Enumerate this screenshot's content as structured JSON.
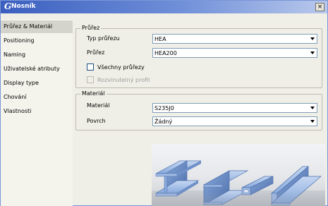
{
  "window": {
    "title": "Nosník",
    "icon": "profile-g-icon",
    "close_label": "×"
  },
  "sidebar": {
    "items": [
      {
        "label": "Průřez & Materiál",
        "active": true
      },
      {
        "label": "Positioning",
        "active": false
      },
      {
        "label": "Naming",
        "active": false
      },
      {
        "label": "Uživatelské atributy",
        "active": false
      },
      {
        "label": "Display type",
        "active": false
      },
      {
        "label": "Chování",
        "active": false
      },
      {
        "label": "Vlastnosti",
        "active": false
      }
    ]
  },
  "profile_group": {
    "title": "Průřez",
    "type_label": "Typ průřezu",
    "type_value": "HEA",
    "profile_label": "Průřez",
    "profile_value": "HEA200",
    "all_profiles_label": "Všechny průřezy",
    "all_profiles_checked": false,
    "parametric_label": "Rozvinutelný profil",
    "parametric_checked": false,
    "parametric_enabled": false
  },
  "material_group": {
    "title": "Materiál",
    "material_label": "Materiál",
    "material_value": "S235J0",
    "surface_label": "Povrch",
    "surface_value": "Žádný"
  },
  "preview": {
    "icon": "steel-profiles-illustration",
    "colors": {
      "steel_light": "#c6d8f3",
      "steel_mid": "#87a9dc",
      "steel_dark": "#4d6ea9"
    }
  },
  "colors": {
    "titlebar_start": "#3b5fbf",
    "titlebar_end": "#b9c9ec",
    "panel_bg": "#f0efe7",
    "active_item_bg": "#d5d4cc"
  }
}
